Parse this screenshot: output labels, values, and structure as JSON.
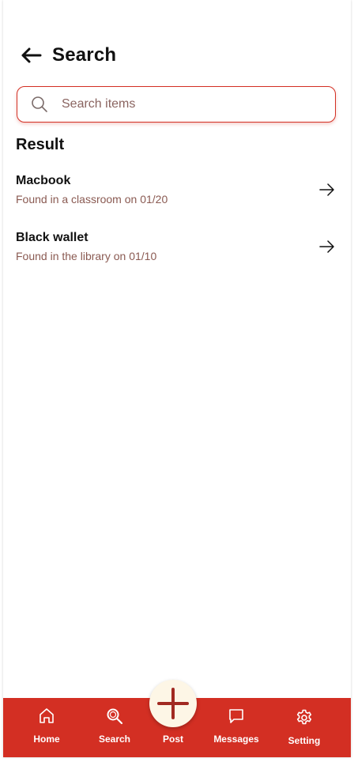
{
  "header": {
    "title": "Search",
    "back_icon": "arrow-left-icon"
  },
  "search": {
    "value": "",
    "placeholder": "Search items",
    "icon": "search-icon"
  },
  "results": {
    "title": "Result",
    "items": [
      {
        "title": "Macbook",
        "subtitle": "Found in a classroom on 01/20",
        "icon": "arrow-right-icon"
      },
      {
        "title": "Black wallet",
        "subtitle": "Found in the library on 01/10",
        "icon": "arrow-right-icon"
      }
    ]
  },
  "nav": {
    "items": [
      {
        "label": "Home",
        "icon": "home-icon"
      },
      {
        "label": "Search",
        "icon": "search-icon"
      },
      {
        "label": "Post",
        "icon": "plus-icon"
      },
      {
        "label": "Messages",
        "icon": "message-icon"
      },
      {
        "label": "Setting",
        "icon": "gear-icon"
      }
    ]
  },
  "colors": {
    "accent": "#d32f23",
    "post_button_bg": "#fdf6e6",
    "subtitle_text": "#8a5a52"
  }
}
